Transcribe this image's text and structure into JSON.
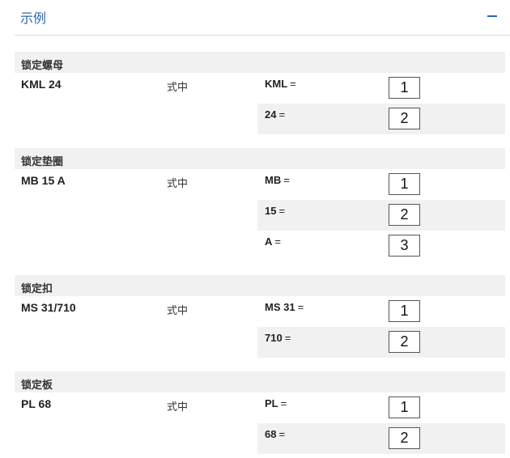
{
  "header": {
    "title": "示例"
  },
  "sections": [
    {
      "title": "锁定螺母",
      "part_number": "KML 24",
      "form_label": "式中",
      "pairs": [
        {
          "key": "KML",
          "eq": "=",
          "num": "1"
        },
        {
          "key": "24",
          "eq": "=",
          "num": "2"
        }
      ]
    },
    {
      "title": "锁定垫圈",
      "part_number": "MB 15 A",
      "form_label": "式中",
      "pairs": [
        {
          "key": "MB",
          "eq": "=",
          "num": "1"
        },
        {
          "key": "15",
          "eq": "=",
          "num": "2"
        },
        {
          "key": "A",
          "eq": "=",
          "num": "3"
        }
      ]
    },
    {
      "title": "锁定扣",
      "part_number": "MS 31/710",
      "form_label": "式中",
      "pairs": [
        {
          "key": "MS 31",
          "eq": "=",
          "num": "1"
        },
        {
          "key": "710",
          "eq": "=",
          "num": "2"
        }
      ]
    },
    {
      "title": "锁定板",
      "part_number": "PL 68",
      "form_label": "式中",
      "pairs": [
        {
          "key": "PL",
          "eq": "=",
          "num": "1"
        },
        {
          "key": "68",
          "eq": "=",
          "num": "2"
        }
      ]
    }
  ]
}
